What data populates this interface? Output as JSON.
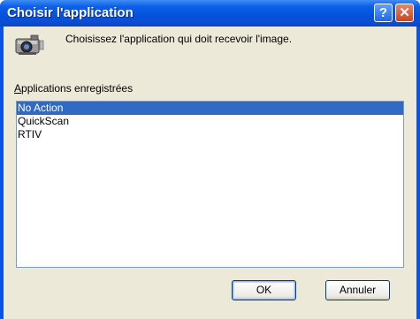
{
  "window": {
    "title": "Choisir l'application",
    "help_label": "?",
    "close_label": "✕"
  },
  "prompt": "Choisissez l'application qui doit recevoir l'image.",
  "list": {
    "label_accel": "A",
    "label_rest": "pplications enregistrées",
    "items": [
      "No Action",
      "QuickScan",
      "RTIV"
    ],
    "selected": "No Action"
  },
  "buttons": {
    "ok": "OK",
    "cancel": "Annuler"
  }
}
